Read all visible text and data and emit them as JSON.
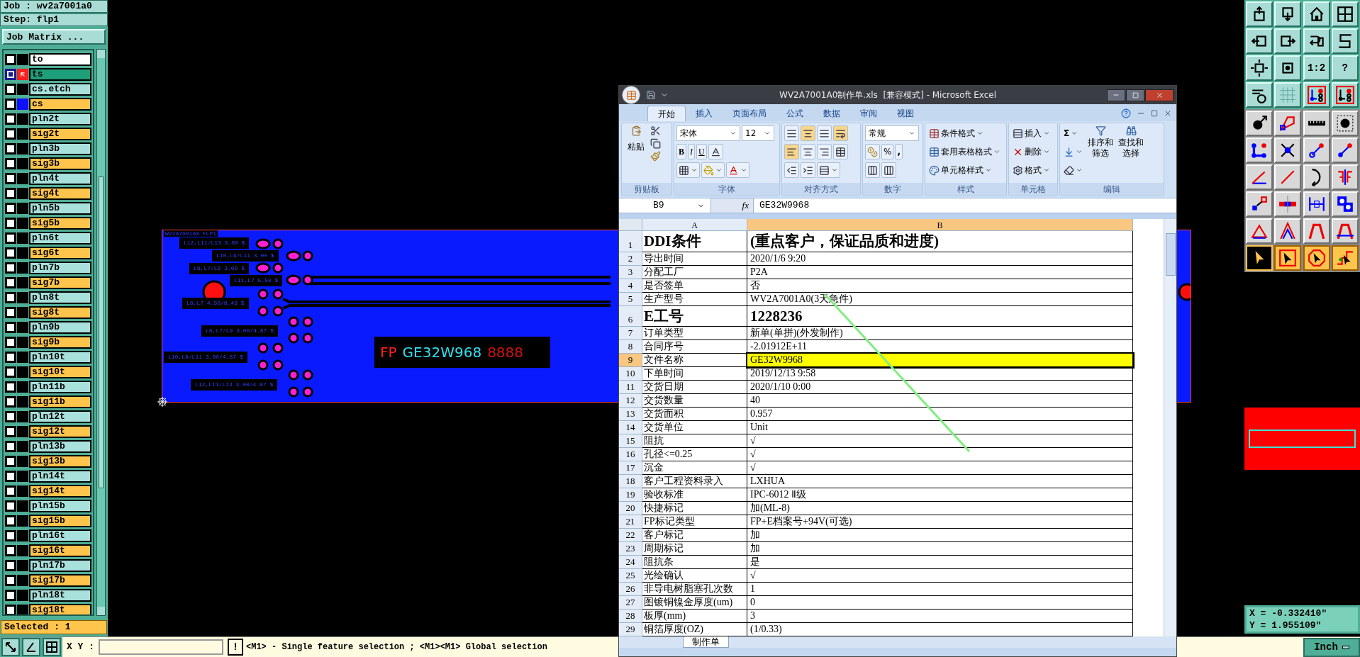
{
  "job_panel": {
    "job": "Job : wv2a7001a0",
    "step": "Step: flp1",
    "matrix_button": "Job Matrix ...",
    "selected_count": "Selected : 1"
  },
  "layers": [
    {
      "name": "to",
      "color": "#ffffff",
      "selected": false
    },
    {
      "name": "ts",
      "color": "#1f9e7a",
      "selected": true,
      "swatch": {
        "color": "#ff2020"
      }
    },
    {
      "name": "cs.etch",
      "color": "#a8e0dc",
      "selected": false
    },
    {
      "name": "cs",
      "color": "#ffc44c",
      "selected": false,
      "swatch": {
        "color": "#1010ff"
      }
    },
    {
      "name": "pln2t",
      "color": "#a8e0dc",
      "selected": false
    },
    {
      "name": "sig2t",
      "color": "#ffc44c",
      "selected": false
    },
    {
      "name": "pln3b",
      "color": "#a8e0dc",
      "selected": false
    },
    {
      "name": "sig3b",
      "color": "#ffc44c",
      "selected": false
    },
    {
      "name": "pln4t",
      "color": "#a8e0dc",
      "selected": false
    },
    {
      "name": "sig4t",
      "color": "#ffc44c",
      "selected": false
    },
    {
      "name": "pln5b",
      "color": "#a8e0dc",
      "selected": false
    },
    {
      "name": "sig5b",
      "color": "#ffc44c",
      "selected": false
    },
    {
      "name": "pln6t",
      "color": "#a8e0dc",
      "selected": false
    },
    {
      "name": "sig6t",
      "color": "#ffc44c",
      "selected": false
    },
    {
      "name": "pln7b",
      "color": "#a8e0dc",
      "selected": false
    },
    {
      "name": "sig7b",
      "color": "#ffc44c",
      "selected": false
    },
    {
      "name": "pln8t",
      "color": "#a8e0dc",
      "selected": false
    },
    {
      "name": "sig8t",
      "color": "#ffc44c",
      "selected": false
    },
    {
      "name": "pln9b",
      "color": "#a8e0dc",
      "selected": false
    },
    {
      "name": "sig9b",
      "color": "#ffc44c",
      "selected": false
    },
    {
      "name": "pln10t",
      "color": "#a8e0dc",
      "selected": false
    },
    {
      "name": "sig10t",
      "color": "#ffc44c",
      "selected": false
    },
    {
      "name": "pln11b",
      "color": "#a8e0dc",
      "selected": false
    },
    {
      "name": "sig11b",
      "color": "#ffc44c",
      "selected": false
    },
    {
      "name": "pln12t",
      "color": "#a8e0dc",
      "selected": false
    },
    {
      "name": "sig12t",
      "color": "#ffc44c",
      "selected": false
    },
    {
      "name": "pln13b",
      "color": "#a8e0dc",
      "selected": false
    },
    {
      "name": "sig13b",
      "color": "#ffc44c",
      "selected": false
    },
    {
      "name": "pln14t",
      "color": "#a8e0dc",
      "selected": false
    },
    {
      "name": "sig14t",
      "color": "#ffc44c",
      "selected": false
    },
    {
      "name": "pln15b",
      "color": "#a8e0dc",
      "selected": false
    },
    {
      "name": "sig15b",
      "color": "#ffc44c",
      "selected": false
    },
    {
      "name": "pln16t",
      "color": "#a8e0dc",
      "selected": false
    },
    {
      "name": "sig16t",
      "color": "#ffc44c",
      "selected": false
    },
    {
      "name": "pln17b",
      "color": "#a8e0dc",
      "selected": false
    },
    {
      "name": "sig17b",
      "color": "#ffc44c",
      "selected": false
    },
    {
      "name": "pln18t",
      "color": "#a8e0dc",
      "selected": false
    },
    {
      "name": "sig18t",
      "color": "#ffc44c",
      "selected": false
    }
  ],
  "board": {
    "title": "WV2A7001A0 FLP1",
    "labels": [
      "L12,L11/L13 3.00 $",
      "L10,L9/L11 3.00 $",
      "L8,L7/L9 3.00 $",
      "L11,L7 5.50 $",
      "L8,L7 4.50/8.43 $",
      "L8,L7/L9 3.00/4.87 $",
      "L10,L9/L11 3.00/4.87 $",
      "L12,L11/L13 3.00/4.87 $"
    ],
    "fp_mark": {
      "prefix": "FP",
      "code": "GE32W968",
      "date_code": "8888"
    }
  },
  "excel": {
    "title": "WV2A7001A0制作单.xls  [兼容模式] - Microsoft Excel",
    "tabs": [
      {
        "label": "开始",
        "selected": true
      },
      {
        "label": "插入",
        "selected": false
      },
      {
        "label": "页面布局",
        "selected": false
      },
      {
        "label": "公式",
        "selected": false
      },
      {
        "label": "数据",
        "selected": false
      },
      {
        "label": "审阅",
        "selected": false
      },
      {
        "label": "视图",
        "selected": false
      }
    ],
    "ribbon": {
      "paste": "粘贴",
      "font": "宋体",
      "font_size": "12",
      "bold": "B",
      "italic": "I",
      "underline": "U",
      "number_format": "常规",
      "percent": "%",
      "comma": ",",
      "conditional_format": "条件格式",
      "table_format": "套用表格格式",
      "cell_style": "单元格样式",
      "insert": "插入",
      "delete": "删除",
      "format": "格式",
      "sum": "Σ",
      "sort_filter": "排序和筛选",
      "find_select": "查找和选择",
      "groups": [
        "剪贴板",
        "字体",
        "对齐方式",
        "数字",
        "样式",
        "单元格",
        "编辑"
      ]
    },
    "name_box": "B9",
    "fx": "fx",
    "formula": "GE32W9968",
    "columns": [
      "A",
      "B"
    ],
    "rows": [
      {
        "num": "1",
        "a": "DDI条件",
        "b": "(重点客户，保证品质和进度)",
        "kind": "large",
        "selected": false
      },
      {
        "num": "2",
        "a": "导出时间",
        "b": "2020/1/6 9:20",
        "kind": "normal",
        "selected": false
      },
      {
        "num": "3",
        "a": "分配工厂",
        "b": "P2A",
        "kind": "normal",
        "selected": false
      },
      {
        "num": "4",
        "a": "是否签单",
        "b": "否",
        "kind": "normal",
        "selected": false
      },
      {
        "num": "5",
        "a": "生产型号",
        "b": "WV2A7001A0(3天急件)",
        "kind": "normal",
        "selected": false
      },
      {
        "num": "6",
        "a": "E工号",
        "b": "1228236",
        "kind": "large",
        "selected": false
      },
      {
        "num": "7",
        "a": "订单类型",
        "b": "新单(单拼)(外发制作)",
        "kind": "normal",
        "selected": false
      },
      {
        "num": "8",
        "a": "合同序号",
        "b": "-2.01912E+11",
        "kind": "normal",
        "selected": false
      },
      {
        "num": "9",
        "a": "文件名称",
        "b": "GE32W9968",
        "kind": "normal",
        "selected": true
      },
      {
        "num": "10",
        "a": "下单时间",
        "b": "2019/12/13 9:58",
        "kind": "normal",
        "selected": false
      },
      {
        "num": "11",
        "a": "交货日期",
        "b": "2020/1/10 0:00",
        "kind": "normal",
        "selected": false
      },
      {
        "num": "12",
        "a": "交货数量",
        "b": "40",
        "kind": "normal",
        "selected": false
      },
      {
        "num": "13",
        "a": "交货面积",
        "b": "0.957",
        "kind": "normal",
        "selected": false
      },
      {
        "num": "14",
        "a": "交货单位",
        "b": "Unit",
        "kind": "normal",
        "selected": false
      },
      {
        "num": "15",
        "a": "阻抗",
        "b": "√",
        "kind": "normal",
        "selected": false
      },
      {
        "num": "16",
        "a": "孔径<=0.25",
        "b": "√",
        "kind": "normal",
        "selected": false
      },
      {
        "num": "17",
        "a": "沉金",
        "b": "√",
        "kind": "normal",
        "selected": false
      },
      {
        "num": "18",
        "a": "客户工程资料录入",
        "b": "LXHUA",
        "kind": "normal",
        "selected": false
      },
      {
        "num": "19",
        "a": "验收标准",
        "b": "IPC-6012 Ⅱ级",
        "kind": "normal",
        "selected": false
      },
      {
        "num": "20",
        "a": "快捷标记",
        "b": "加(ML-8)",
        "kind": "normal",
        "selected": false
      },
      {
        "num": "21",
        "a": "FP标记类型",
        "b": "FP+E档案号+94V(可选)",
        "kind": "normal",
        "selected": false
      },
      {
        "num": "22",
        "a": "客户标记",
        "b": "加",
        "kind": "normal",
        "selected": false
      },
      {
        "num": "23",
        "a": "周期标记",
        "b": "加",
        "kind": "normal",
        "selected": false
      },
      {
        "num": "24",
        "a": "阻抗条",
        "b": "是",
        "kind": "normal",
        "selected": false
      },
      {
        "num": "25",
        "a": "光绘确认",
        "b": "√",
        "kind": "normal",
        "selected": false
      },
      {
        "num": "26",
        "a": "非导电树脂塞孔次数",
        "b": "1",
        "kind": "normal",
        "selected": false
      },
      {
        "num": "27",
        "a": "图镀铜镍金厚度(um)",
        "b": "0",
        "kind": "normal",
        "selected": false
      },
      {
        "num": "28",
        "a": "板厚(mm)",
        "b": "3",
        "kind": "normal",
        "selected": false
      },
      {
        "num": "29",
        "a": "铜箔厚度(OZ)",
        "b": "(1/0.33)",
        "kind": "normal",
        "selected": false
      }
    ],
    "sheet_tab": "制作单"
  },
  "right_toolbar": {
    "ratio_label": "1:2",
    "help_label": "?",
    "select_tools": [
      {
        "selected": true
      },
      {
        "selected": false
      },
      {
        "selected": false
      },
      {
        "selected": false
      }
    ]
  },
  "coordinates": {
    "x": "X = -0.332410\"",
    "y": "Y = 1.955109\""
  },
  "bottom_bar": {
    "xy_label": "X Y :",
    "alert_button": "!",
    "message": "<M1> - Single feature selection ; <M1><M1> Global selection",
    "units": "Inch"
  }
}
